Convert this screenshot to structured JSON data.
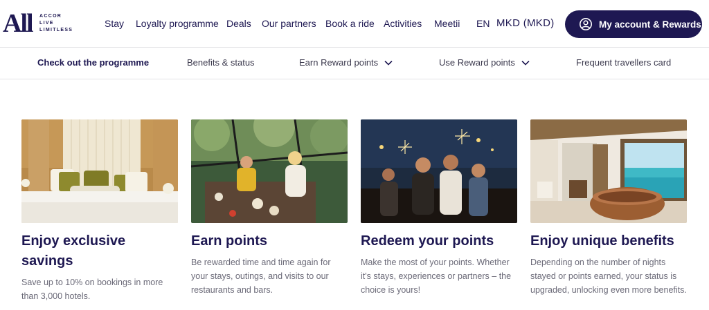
{
  "logo": {
    "brand": "All",
    "tagline": [
      "ACCOR",
      "LIVE",
      "LIMITLESS"
    ]
  },
  "nav": {
    "items": [
      {
        "label": "Stay"
      },
      {
        "label": "Loyalty programme"
      },
      {
        "label": "Deals"
      },
      {
        "label": "Our partners"
      },
      {
        "label": "Book a ride"
      },
      {
        "label": "Activities"
      },
      {
        "label": "Meetii"
      }
    ],
    "language": "EN",
    "currency": "MKD (MKD)",
    "account_button": "My account & Rewards",
    "account_icon": "user-circle-icon"
  },
  "subnav": {
    "items": [
      {
        "label": "Check out the programme",
        "active": true
      },
      {
        "label": "Benefits & status"
      },
      {
        "label": "Earn Reward points",
        "dropdown": true
      },
      {
        "label": "Use Reward points",
        "dropdown": true
      },
      {
        "label": "Frequent travellers card"
      }
    ]
  },
  "cards": [
    {
      "title": "Enjoy exclusive savings",
      "description": "Save up to 10% on bookings in more than 3,000 hotels.",
      "image": "hotel-bedroom-photo"
    },
    {
      "title": "Earn points",
      "description": "Be rewarded time and time again for your stays, outings, and visits to our restaurants and bars.",
      "image": "friends-dining-outdoors-photo"
    },
    {
      "title": "Redeem your points",
      "description": "Make the most of your points. Whether it's stays, experiences or partners – the choice is yours!",
      "image": "party-sparklers-photo"
    },
    {
      "title": "Enjoy unique benefits",
      "description": "Depending on the number of nights stayed or points earned, your status is upgraded, unlocking even more benefits.",
      "image": "ocean-villa-bathtub-photo"
    }
  ],
  "colors": {
    "brand_navy": "#1e1852",
    "text_muted": "#6b6a78",
    "divider": "#e2e2e6"
  }
}
